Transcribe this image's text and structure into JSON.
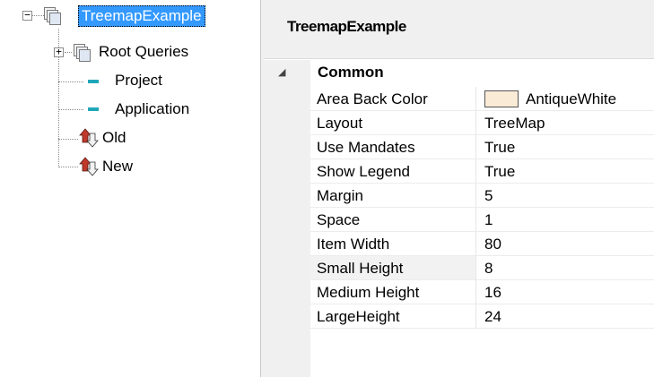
{
  "tree": {
    "root": {
      "label": "TreemapExample",
      "expanded": true,
      "selected": true
    },
    "children": [
      {
        "label": "Root Queries",
        "icon": "documents-icon",
        "expandable": true
      },
      {
        "label": "Project",
        "icon": "teal-dash-icon"
      },
      {
        "label": "Application",
        "icon": "teal-dash-icon"
      },
      {
        "label": "Old",
        "icon": "up-down-arrows-icon"
      },
      {
        "label": "New",
        "icon": "up-down-arrows-icon"
      }
    ],
    "expander_open": "−",
    "expander_closed": "+"
  },
  "props": {
    "title": "TreemapExample",
    "category": "Common",
    "category_arrow": "◢",
    "rows": [
      {
        "name": "Area Back Color",
        "value": "AntiqueWhite",
        "swatch": "#faebd7"
      },
      {
        "name": "Layout",
        "value": "TreeMap"
      },
      {
        "name": "Use Mandates",
        "value": "True"
      },
      {
        "name": "Show Legend",
        "value": "True"
      },
      {
        "name": "Margin",
        "value": "5"
      },
      {
        "name": "Space",
        "value": "1"
      },
      {
        "name": "Item Width",
        "value": "80"
      },
      {
        "name": "Small Height",
        "value": "8"
      },
      {
        "name": "Medium Height",
        "value": "16"
      },
      {
        "name": "LargeHeight",
        "value": "24"
      }
    ]
  },
  "colors": {
    "selection": "#3399ff",
    "teal": "#1fa7b8",
    "arrow_red": "#c0392b"
  }
}
